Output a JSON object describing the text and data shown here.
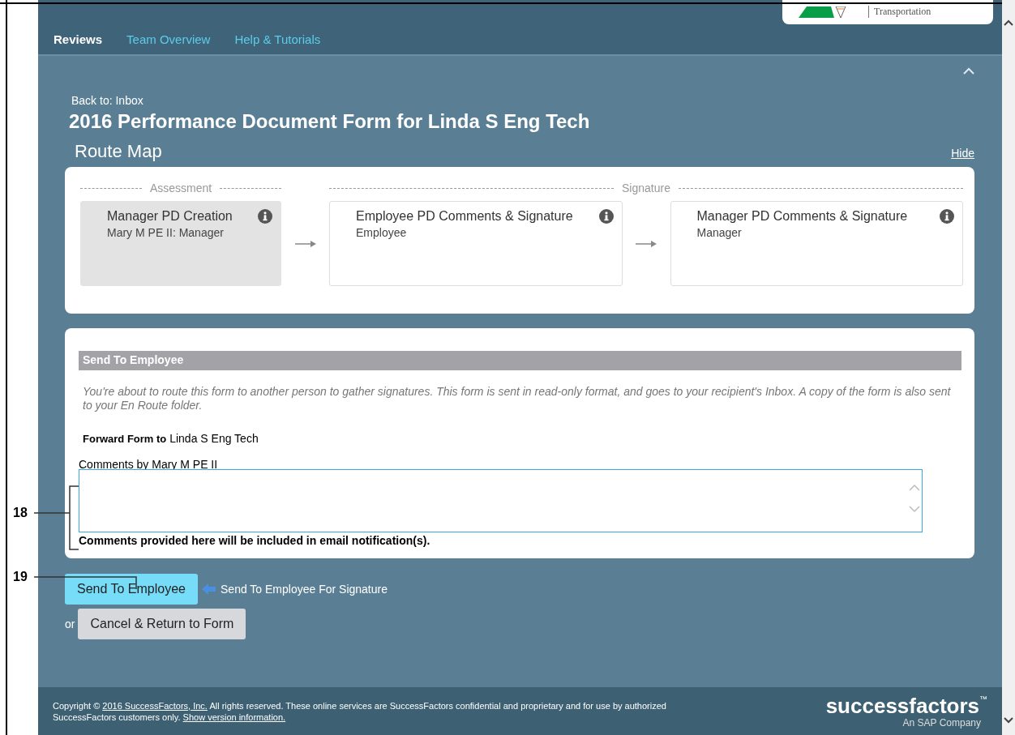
{
  "header": {
    "logo_text": "Transportation"
  },
  "nav": {
    "tabs": [
      {
        "label": "Reviews",
        "selected": true
      },
      {
        "label": "Team Overview",
        "selected": false
      },
      {
        "label": "Help & Tutorials",
        "selected": false
      }
    ]
  },
  "back_link": "Back to: Inbox",
  "title": "2016 Performance Document Form for Linda S Eng Tech",
  "route_map": {
    "title": "Route Map",
    "hide_link": "Hide",
    "stages": [
      {
        "label": "Assessment",
        "steps": [
          {
            "title": "Manager PD Creation",
            "subtitle": "Mary M PE II: Manager",
            "current": true
          }
        ]
      },
      {
        "label": "Signature",
        "steps": [
          {
            "title": "Employee PD Comments & Signature",
            "subtitle": "Employee",
            "current": false
          },
          {
            "title": "Manager PD Comments & Signature",
            "subtitle": "Manager",
            "current": false
          }
        ]
      }
    ]
  },
  "send_panel": {
    "heading": "Send To Employee",
    "message": "You're about to route this form to another person to gather signatures. This form is sent in read-only format, and goes to your recipient's Inbox. A copy of the form is also sent to your En Route folder.",
    "forward_label": "Forward Form to",
    "forward_name": "Linda S Eng Tech",
    "comments_label": "Comments by Mary M PE II",
    "note": "Comments provided here will be included in email notification(s)."
  },
  "actions": {
    "primary": "Send To Employee",
    "hint": "Send To Employee For Signature",
    "or": "or",
    "cancel": "Cancel & Return to Form"
  },
  "footer": {
    "copyright_prefix": "Copyright ©",
    "copyright_link": "2016 SuccessFactors, Inc.",
    "copyright_text": "All rights reserved. These online services are SuccessFactors confidential and proprietary and for use by authorized SuccessFactors customers only.",
    "version_link": "Show version information.",
    "brand": "successfactors",
    "trademark": "™",
    "tagline": "An SAP Company"
  },
  "annotations": [
    {
      "label": "18"
    },
    {
      "label": "19"
    }
  ]
}
